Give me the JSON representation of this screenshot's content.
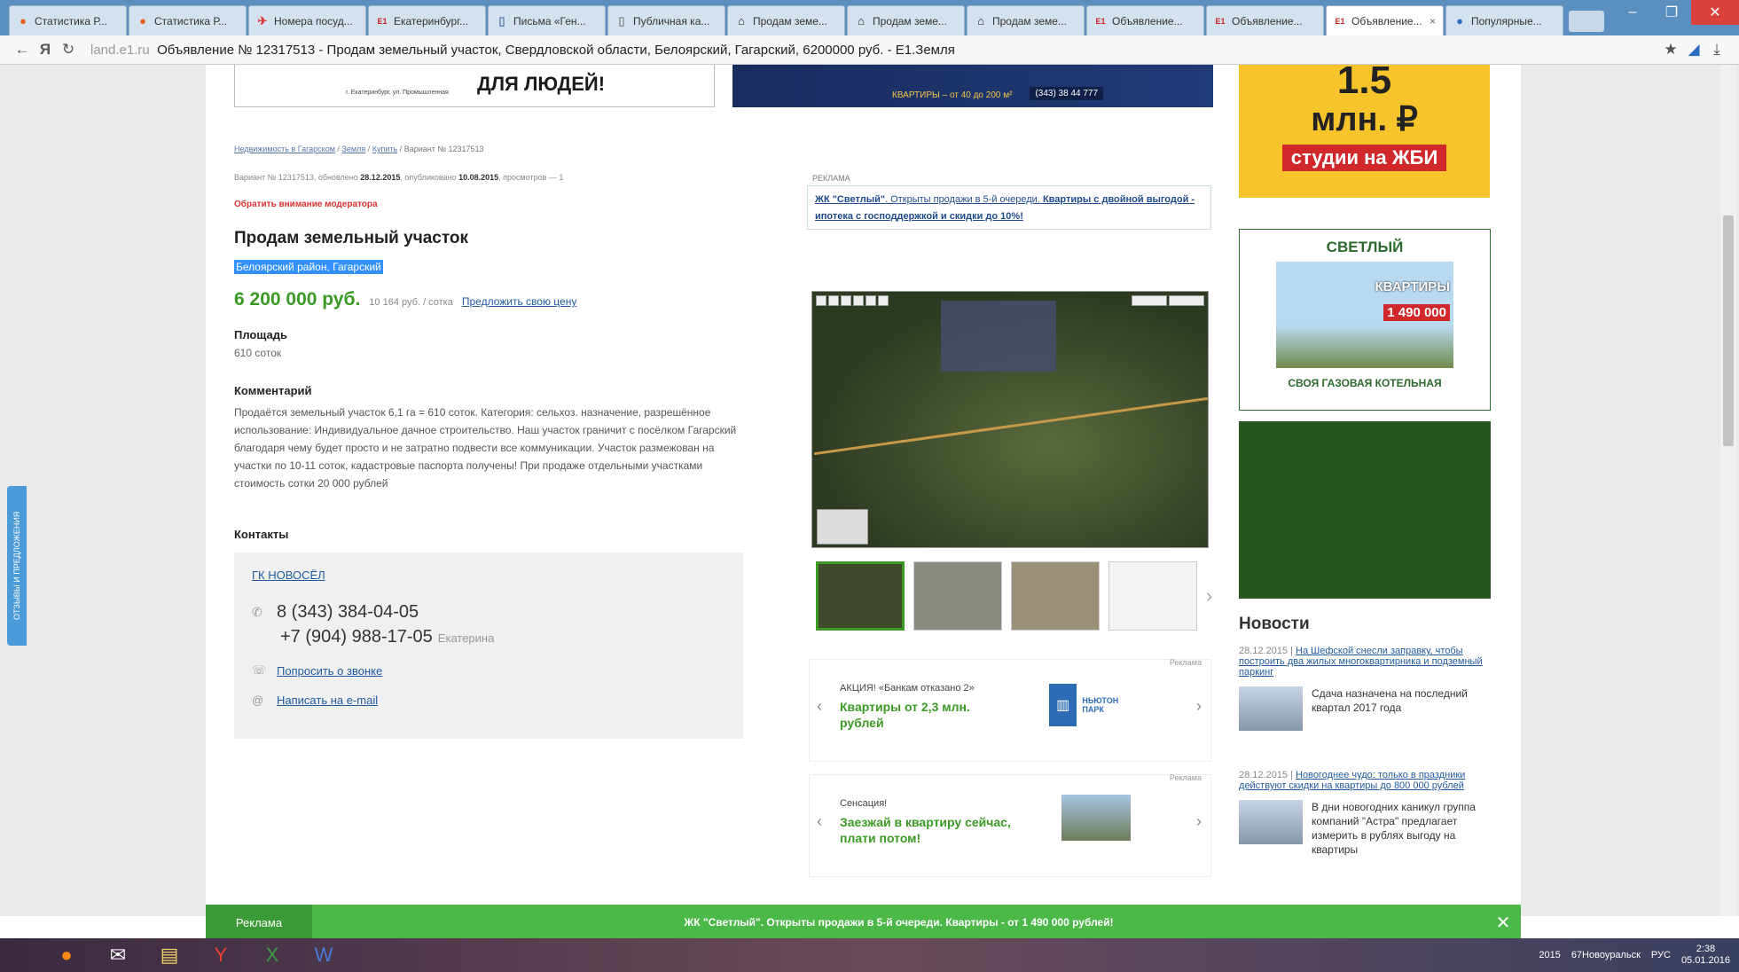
{
  "browser": {
    "tabs": [
      {
        "label": "Статистика Р...",
        "icon": "orange-dot-icon",
        "color": "#e8641e"
      },
      {
        "label": "Статистика Р...",
        "icon": "orange-dot-icon",
        "color": "#e8641e"
      },
      {
        "label": "Номера посуд...",
        "icon": "plane-icon",
        "color": "#d33"
      },
      {
        "label": "Екатеринбург...",
        "icon": "e1-logo-icon",
        "color": "#c22"
      },
      {
        "label": "Письма «Ген...",
        "icon": "page-icon",
        "color": "#5577aa"
      },
      {
        "label": "Публичная ка...",
        "icon": "page-icon",
        "color": "#888"
      },
      {
        "label": "Продам земе...",
        "icon": "house-icon",
        "color": "#222"
      },
      {
        "label": "Продам земе...",
        "icon": "house-icon",
        "color": "#222"
      },
      {
        "label": "Продам земе...",
        "icon": "house-icon",
        "color": "#222"
      },
      {
        "label": "Объявление...",
        "icon": "e1-logo-icon",
        "color": "#c22"
      },
      {
        "label": "Объявление...",
        "icon": "e1-logo-icon",
        "color": "#c22"
      },
      {
        "label": "Объявление...",
        "icon": "e1-logo-icon",
        "color": "#c22",
        "active": true
      },
      {
        "label": "Популярные...",
        "icon": "blue-square-icon",
        "color": "#2a6cc0"
      }
    ],
    "address": {
      "domain": "land.e1.ru",
      "title": "Объявление № 12317513 - Продам земельный участок, Свердловской области, Белоярский, Гагарский, 6200000 руб. - E1.Земля"
    }
  },
  "top_banners": {
    "left_small": "г. Екатеринбург, ул. Промышленная",
    "left_big": "ДЛЯ ЛЮДЕЙ!",
    "right_text": "КВАРТИРЫ – от 40 до 200 м²",
    "right_phone": "(343) 38 44 777"
  },
  "listing": {
    "breadcrumbs": [
      "Недвижимость в Гагарском",
      "Земля",
      "Купить",
      "Вариант № 12317513"
    ],
    "meta_prefix": "Вариант № ",
    "meta_id": "12317513",
    "meta_created_label": ", обновлено ",
    "meta_created": "28.12.2015",
    "meta_published_label": ", опубликовано ",
    "meta_published": "10.08.2015",
    "meta_views": ", просмотров — 1",
    "moderator_link": "Обратить внимание модератора",
    "title": "Продам земельный участок",
    "location": "Белоярский район, Гагарский",
    "price": "6 200 000 руб.",
    "price_per": "10 164 руб. / сотка",
    "offer_link": "Предложить свою цену",
    "area_label": "Площадь",
    "area_value": "610 соток",
    "comment_label": "Комментарий",
    "comment_text": "Продаётся земельный участок 6,1 га = 610 соток. Категория: сельхоз. назначение, разрешённое использование: Индивидуальное дачное строительство. Наш участок граничит с посёлком Гагарский благодаря чему будет просто и не затратно подвести все коммуникации. Участок размежован на участки по 10-11 соток, кадастровые паспорта получены! При продаже отдельными участками стоимость сотки 20 000 рублей",
    "contacts_label": "Контакты",
    "contacts": {
      "org": "ГК НОВОСЁЛ",
      "phone1": "8 (343) 384-04-05",
      "phone2": "+7 (904) 988-17-05",
      "phone2_name": "Екатерина",
      "callback": "Попросить о звонке",
      "email": "Написать на e-mail"
    }
  },
  "ad_block": {
    "label": "РЕКЛАМА",
    "text_bold": "ЖК \"Светлый\"",
    "text_link": ". Открыты продажи в 5-й очереди. ",
    "text_bold2": "Квартиры с двойной выгодой - ипотека с господдержкой и скидки до 10%!"
  },
  "promo_cards": [
    {
      "label": "Реклама",
      "line1": "АКЦИЯ! «Банкам отказано 2»",
      "line2": "Квартиры от 2,3 млн. рублей",
      "logo": "НЬЮТОН ПАРК"
    },
    {
      "label": "Реклама",
      "line1": "Сенсация!",
      "line2": "Заезжай в квартиру сейчас, плати потом!"
    }
  ],
  "right_banners": {
    "b1_num": "1.5",
    "b1_unit": "млн. ₽",
    "b1_caption": "студии на ЖБИ",
    "b2_logo": "СВЕТЛЫЙ",
    "b2_kv": "КВАРТИРЫ",
    "b2_price": "1 490 000",
    "b2_footer": "СВОЯ ГАЗОВАЯ КОТЕЛЬНАЯ"
  },
  "news": {
    "title": "Новости",
    "items": [
      {
        "date": "28.12.2015 |",
        "link": "На Шефской снесли заправку, чтобы построить два жилых многоквартирника и подземный паркинг",
        "text": "Сдача назначена на последний квартал 2017 года"
      },
      {
        "date": "28.12.2015 |",
        "link": "Новогоднее чудо: только в праздники действуют скидки на квартиры до 800 000 рублей",
        "text": "В дни новогодних каникул группа компаний \"Астра\" предлагает измерить в рублях выгоду на квартиры"
      }
    ]
  },
  "feedback_tab": "ОТЗЫВЫ И ПРЕДЛОЖЕНИЯ",
  "bottom_bar": {
    "label": "Реклама",
    "message": "ЖК \"Светлый\". Открыты продажи в 5-й очереди. Квартиры - от 1 490 000 рублей!"
  },
  "taskbar": {
    "year": "2015",
    "folder": "67Новоуральск",
    "lang": "РУС",
    "time": "2:38",
    "date": "05.01.2016"
  }
}
